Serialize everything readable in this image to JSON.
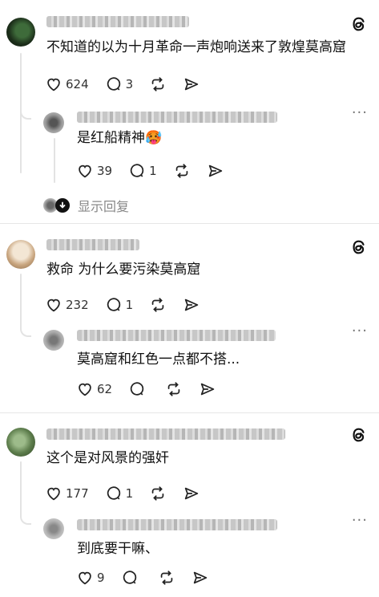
{
  "posts": [
    {
      "username": "user_blurred_1",
      "text": "不知道的以为十月革命一声炮响送来了敦煌莫高窟",
      "likes": "624",
      "replies": "3",
      "reply": {
        "username": "user_blurred_2",
        "text": "是红船精神🥵",
        "likes": "39",
        "replies": "1"
      },
      "show_replies_label": "显示回复"
    },
    {
      "username": "user_blurred_3",
      "text": "救命 为什么要污染莫高窟",
      "likes": "232",
      "replies": "1",
      "reply": {
        "username": "user_blurred_4",
        "text": "莫高窟和红色一点都不搭...",
        "likes": "62",
        "replies": ""
      }
    },
    {
      "username": "user_blurred_5",
      "text": "这个是对风景的强奸",
      "likes": "177",
      "replies": "1",
      "reply": {
        "username": "user_blurred_6",
        "text": "到底要干嘛、",
        "likes": "9",
        "replies": ""
      }
    }
  ],
  "icons": {
    "threads": "threads-logo-icon",
    "like": "heart-icon",
    "reply": "comment-icon",
    "repost": "repost-icon",
    "share": "send-icon",
    "more": "more-icon"
  },
  "colors": {
    "text": "#111111",
    "muted": "#888888",
    "divider": "#e6e6e6"
  }
}
